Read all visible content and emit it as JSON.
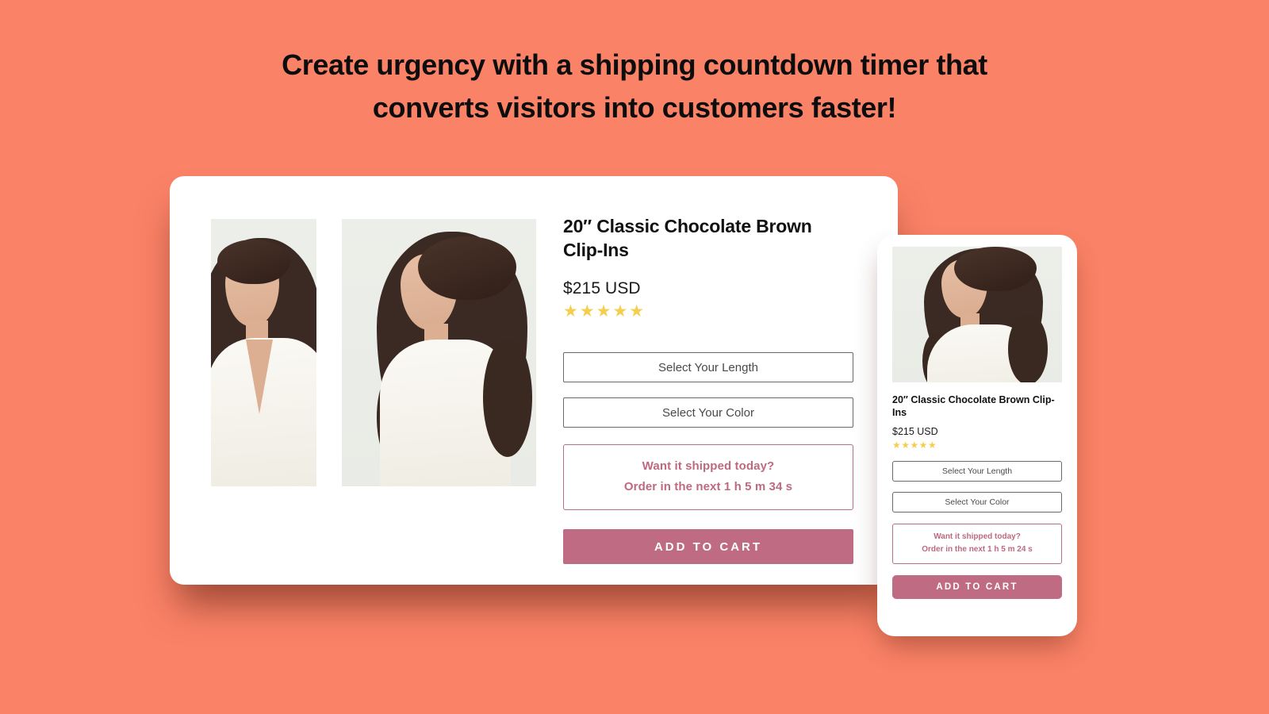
{
  "headline": {
    "line1": "Create urgency with a shipping countdown timer that",
    "line2": "converts visitors into customers faster!"
  },
  "colors": {
    "background": "#FA8266",
    "card": "#FFFFFF",
    "accent_button": "#BF6B84",
    "countdown_text": "#BD6A80",
    "countdown_border": "#B4717F",
    "star": "#F5CE4E",
    "field_border": "#696969",
    "photo_bg": "#EEF0EC"
  },
  "desktop": {
    "gallery": {
      "thumbnail_alt": "model-front-view-photo",
      "main_alt": "model-side-view-photo"
    },
    "product": {
      "title": "20″ Classic Chocolate Brown Clip-Ins",
      "price": "$215 USD",
      "rating_stars": "★★★★★",
      "rating_value": 5
    },
    "fields": [
      {
        "name": "length",
        "label": "Select Your Length"
      },
      {
        "name": "color",
        "label": "Select Your Color"
      }
    ],
    "countdown": {
      "question": "Want it shipped today?",
      "order_text": "Order in the next 1 h 5 m 34 s",
      "hours": 1,
      "minutes": 5,
      "seconds": 34
    },
    "cta": "ADD TO CART"
  },
  "mobile": {
    "photo_alt": "model-side-view-photo",
    "product": {
      "title": "20″ Classic Chocolate Brown Clip-Ins",
      "price": "$215 USD",
      "rating_stars": "★★★★★",
      "rating_value": 5
    },
    "fields": [
      {
        "name": "length",
        "label": "Select Your Length"
      },
      {
        "name": "color",
        "label": "Select Your Color"
      }
    ],
    "countdown": {
      "question": "Want it shipped today?",
      "order_text": "Order in the next 1 h 5 m 24 s",
      "hours": 1,
      "minutes": 5,
      "seconds": 24
    },
    "cta": "ADD TO CART"
  }
}
